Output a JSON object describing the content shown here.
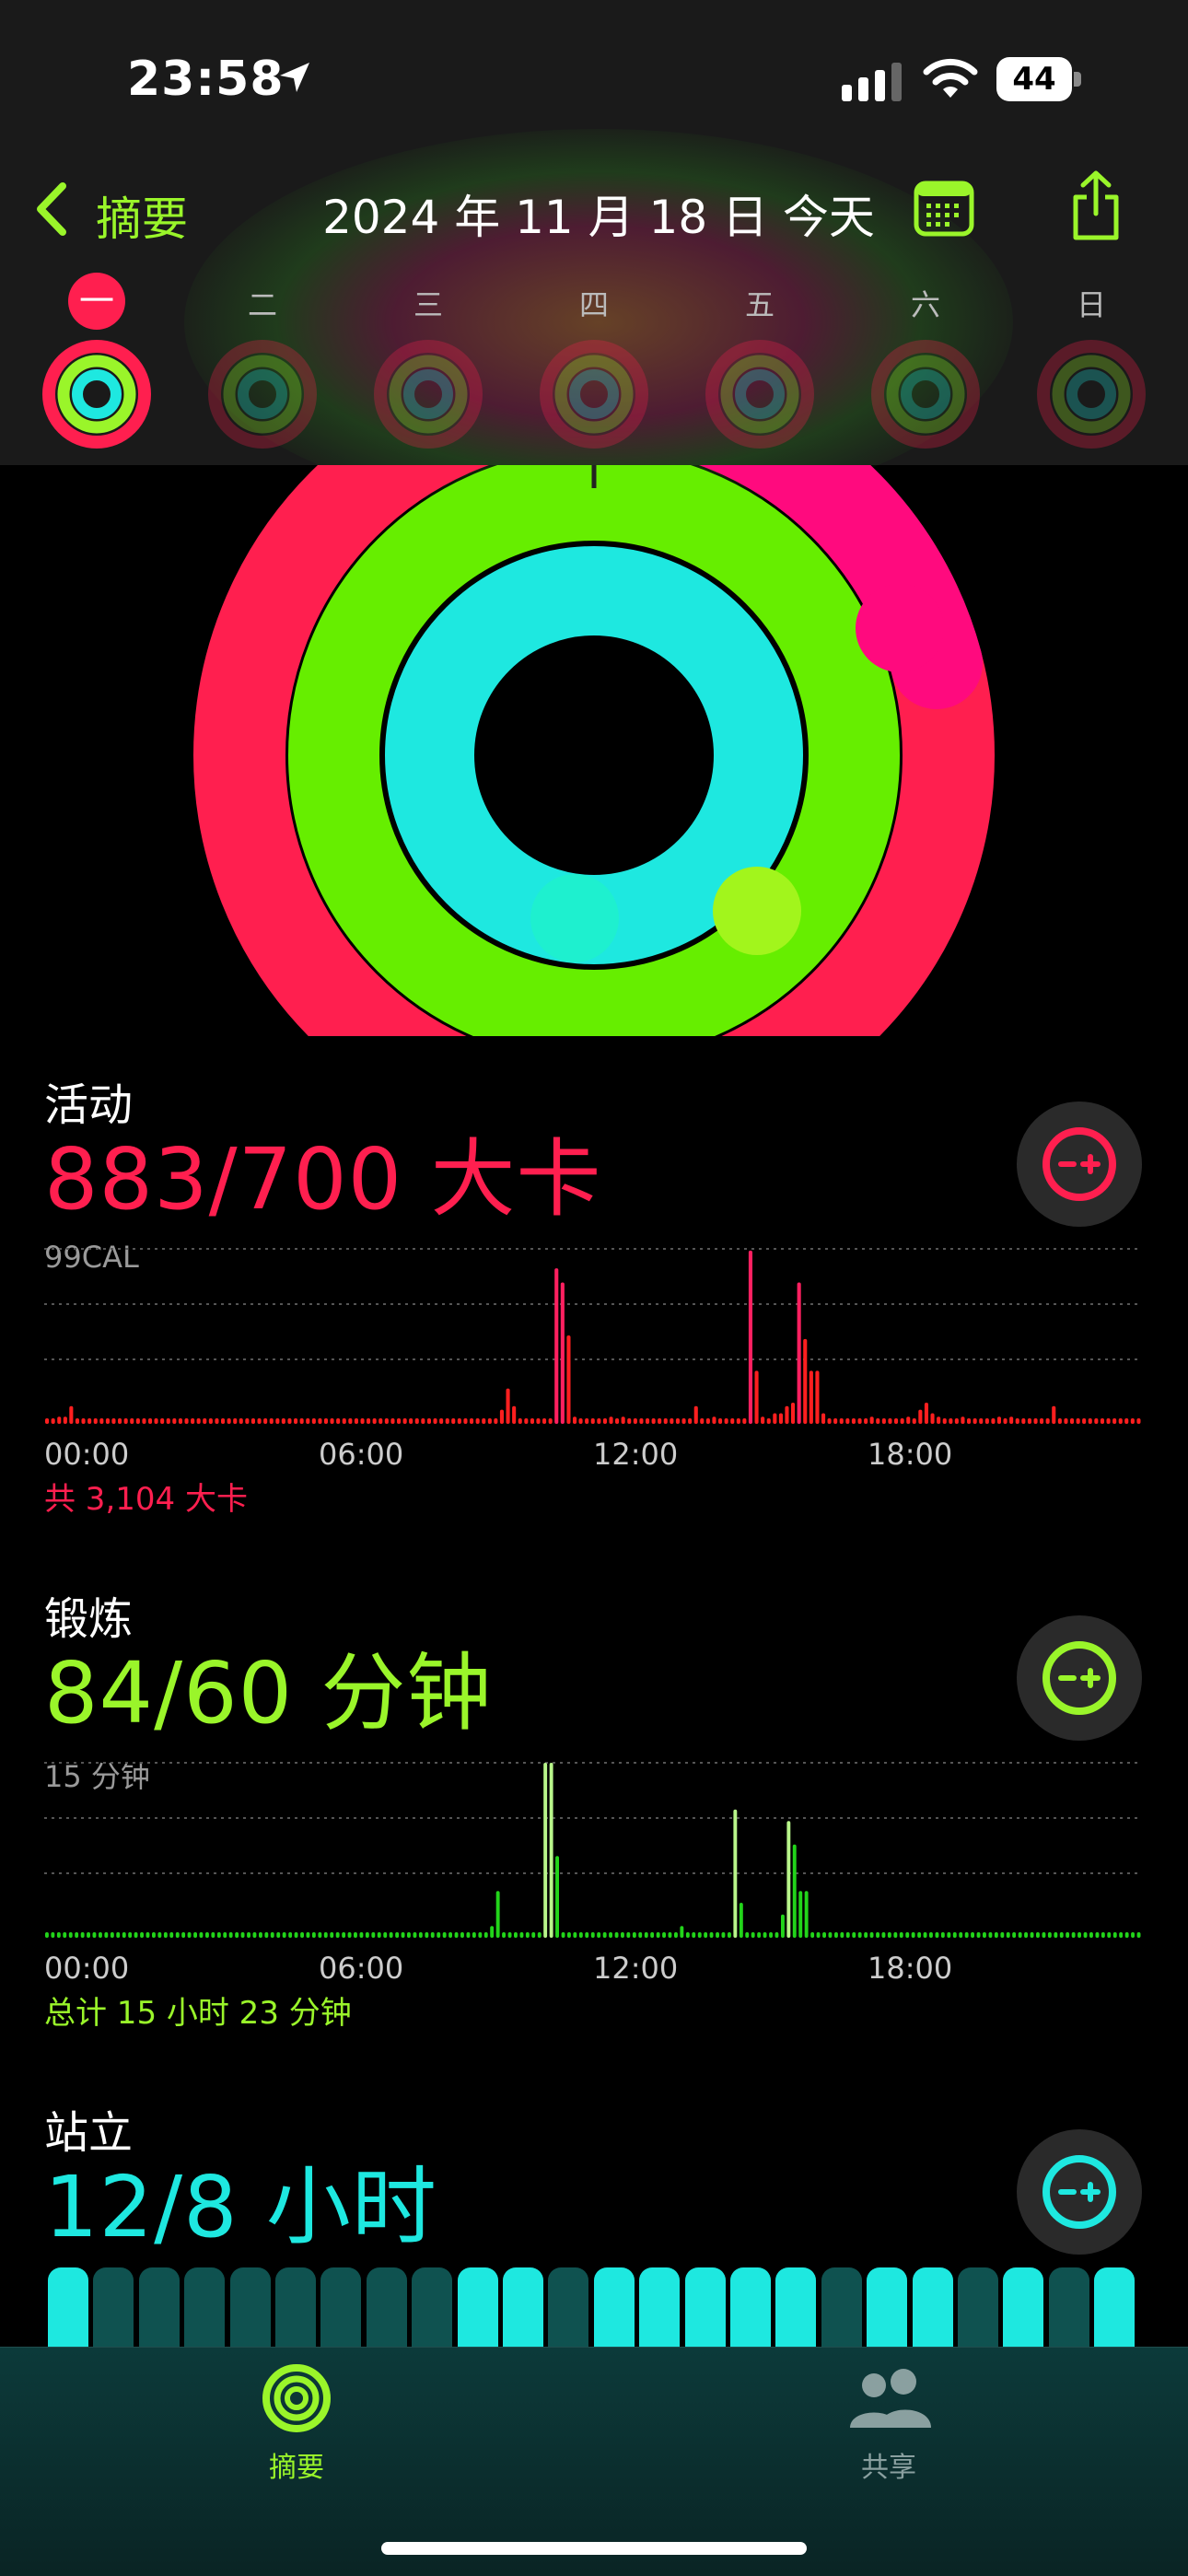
{
  "status": {
    "time": "23:58",
    "battery": "44"
  },
  "header": {
    "back_label": "摘要",
    "title": "2024 年 11 月 18 日 今天",
    "days": [
      "一",
      "二",
      "三",
      "四",
      "五",
      "六",
      "日"
    ],
    "selected_day_index": 0
  },
  "rings": {
    "move_progress": 1.26,
    "exercise_progress": 1.4,
    "stand_progress": 1.5
  },
  "move": {
    "label": "活动",
    "value": "883/700 大卡",
    "scale": "99CAL",
    "axis": [
      "00:00",
      "06:00",
      "12:00",
      "18:00"
    ],
    "total": "共 3,104 大卡",
    "color": "#ff1f4f"
  },
  "exercise": {
    "label": "锻炼",
    "value": "84/60 分钟",
    "scale": "15 分钟",
    "axis": [
      "00:00",
      "06:00",
      "12:00",
      "18:00"
    ],
    "total": "总计 15 小时 23 分钟",
    "color": "#9af52a"
  },
  "stand": {
    "label": "站立",
    "value": "12/8 小时",
    "color": "#1ee8e0",
    "hours": [
      1,
      0,
      0,
      0,
      0,
      0,
      0,
      0,
      0,
      1,
      1,
      0,
      1,
      1,
      1,
      1,
      1,
      0,
      1,
      1,
      0,
      1,
      0,
      1
    ]
  },
  "chart_data": [
    {
      "type": "bar",
      "title": "活动",
      "ylabel": "99CAL",
      "ylim": [
        0,
        99
      ],
      "x": [
        "00:00",
        "06:00",
        "12:00",
        "18:00"
      ],
      "series": [
        {
          "values": [
            2,
            2,
            4,
            4,
            10,
            2,
            2,
            2,
            2,
            2,
            2,
            2,
            2,
            2,
            2,
            2,
            2,
            2,
            2,
            2,
            2,
            2,
            2,
            2,
            2,
            2,
            2,
            2,
            2,
            2,
            2,
            2,
            2,
            2,
            2,
            2,
            2,
            2,
            2,
            2,
            2,
            2,
            2,
            2,
            2,
            2,
            2,
            2,
            2,
            2,
            2,
            2,
            2,
            2,
            2,
            2,
            2,
            2,
            2,
            2,
            2,
            2,
            2,
            2,
            2,
            2,
            2,
            2,
            2,
            2,
            2,
            2,
            2,
            2,
            2,
            8,
            20,
            10,
            2,
            2,
            2,
            2,
            2,
            2,
            88,
            80,
            50,
            4,
            2,
            2,
            2,
            2,
            2,
            4,
            2,
            4,
            2,
            2,
            2,
            2,
            2,
            2,
            2,
            2,
            2,
            2,
            2,
            10,
            2,
            2,
            4,
            2,
            2,
            2,
            2,
            2,
            98,
            30,
            4,
            2,
            6,
            6,
            10,
            12,
            80,
            48,
            30,
            30,
            6,
            2,
            2,
            2,
            2,
            2,
            2,
            2,
            4,
            2,
            2,
            2,
            2,
            2,
            4,
            2,
            8,
            12,
            6,
            4,
            2,
            2,
            2,
            4,
            2,
            2,
            2,
            2,
            2,
            4,
            2,
            4,
            2,
            2,
            2,
            2,
            2,
            2,
            10,
            2,
            2,
            2,
            2,
            2,
            2,
            2,
            2,
            2,
            2,
            2,
            2,
            2,
            2
          ]
        }
      ]
    },
    {
      "type": "bar",
      "title": "锻炼",
      "ylabel": "15 分钟",
      "ylim": [
        0,
        15
      ],
      "x": [
        "00:00",
        "06:00",
        "12:00",
        "18:00"
      ],
      "series": [
        {
          "values": [
            0,
            0,
            0,
            0,
            0,
            0,
            0,
            0,
            0,
            0,
            0,
            0,
            0,
            0,
            0,
            0,
            0,
            0,
            0,
            0,
            0,
            0,
            0,
            0,
            0,
            0,
            0,
            0,
            0,
            0,
            0,
            0,
            0,
            0,
            0,
            0,
            0,
            0,
            0,
            0,
            0,
            0,
            0,
            0,
            0,
            0,
            0,
            0,
            0,
            0,
            0,
            0,
            0,
            0,
            0,
            0,
            0,
            0,
            0,
            0,
            0,
            0,
            0,
            0,
            0,
            0,
            0,
            0,
            0,
            0,
            0,
            0,
            0,
            0,
            0,
            1,
            4,
            0,
            0,
            0,
            0,
            0,
            0,
            0,
            15,
            15,
            7,
            0,
            0,
            0,
            0,
            0,
            0,
            0,
            0,
            0,
            0,
            0,
            0,
            0,
            0,
            0,
            0,
            0,
            0,
            0,
            0,
            1,
            0,
            0,
            0,
            0,
            0,
            0,
            0,
            0,
            11,
            3,
            0,
            0,
            0,
            0,
            0,
            0,
            2,
            10,
            8,
            4,
            4,
            0,
            0,
            0,
            0,
            0,
            0,
            0,
            0,
            0,
            0,
            0,
            0,
            0,
            0,
            0,
            0,
            0,
            0,
            0,
            0,
            0,
            0,
            0,
            0,
            0,
            0,
            0,
            0,
            0,
            0,
            0,
            0,
            0,
            0,
            0,
            0,
            0,
            0,
            0,
            0,
            0,
            0,
            0,
            0,
            0,
            0,
            0,
            0,
            0,
            0,
            0,
            0,
            0,
            0,
            0,
            0
          ]
        }
      ]
    }
  ],
  "tabs": [
    {
      "label": "摘要",
      "active": true,
      "icon": "activity-rings-icon"
    },
    {
      "label": "共享",
      "active": false,
      "icon": "people-icon"
    }
  ]
}
